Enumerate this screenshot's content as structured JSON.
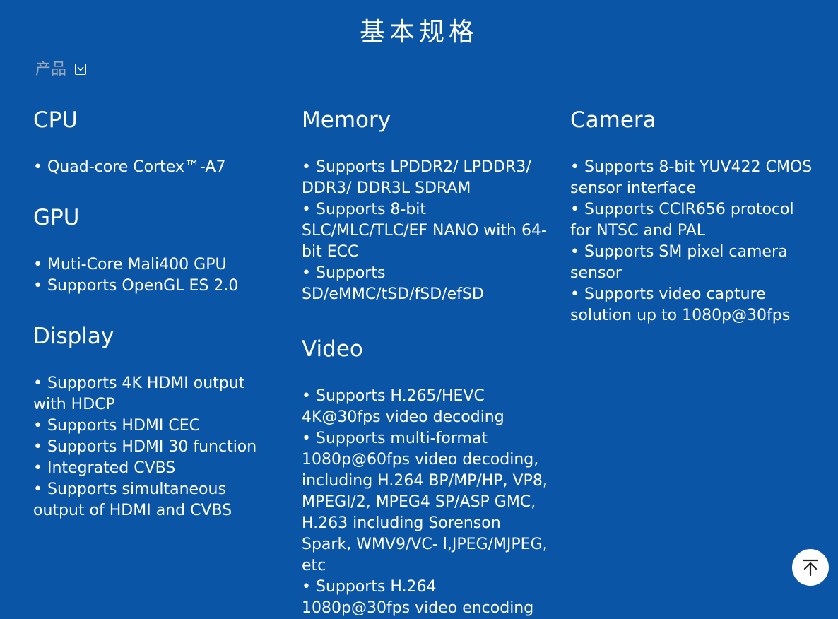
{
  "page_title": "基本规格",
  "filter": {
    "label": "产品",
    "icon": "chevron-down-icon"
  },
  "sections": {
    "cpu": {
      "title": "CPU",
      "items": [
        "Quad-core Cortex™-A7"
      ]
    },
    "gpu": {
      "title": "GPU",
      "items": [
        "Muti-Core Mali400 GPU",
        "Supports OpenGL ES 2.0"
      ]
    },
    "display": {
      "title": "Display",
      "items": [
        "Supports 4K HDMI output with HDCP",
        "Supports HDMI CEC",
        "Supports HDMI 30 function",
        "Integrated CVBS",
        "Supports simultaneous output of HDMI and CVBS"
      ]
    },
    "memory": {
      "title": "Memory",
      "items": [
        "Supports LPDDR2/ LPDDR3/ DDR3/ DDR3L SDRAM",
        "Supports 8-bit SLC/MLC/TLC/EF NANO with 64-bit ECC",
        "Supports SD/eMMC/tSD/fSD/efSD"
      ]
    },
    "video": {
      "title": "Video",
      "items": [
        "Supports H.265/HEVC 4K@30fps video decoding",
        "Supports multi-format 1080p@60fps video decoding, including H.264 BP/MP/HP, VP8, MPEGl/2, MPEG4 SP/ASP GMC, H.263 including Sorenson Spark, WMV9/VC- l,JPEG/MJPEG, etc",
        "Supports H.264 1080p@30fps video encoding"
      ]
    },
    "camera": {
      "title": "Camera",
      "items": [
        "Supports 8-bit YUV422 CMOS sensor interface",
        "Supports CCIR656 protocol for NTSC and PAL",
        "Supports SM pixel camera sensor",
        "Supports video capture solution up to 1080p@30fps"
      ]
    }
  },
  "back_to_top": {
    "icon": "arrow-up-to-top-icon"
  },
  "colors": {
    "background": "#0a55a6",
    "text": "#ffffff",
    "filter_label": "#9aa7b8"
  }
}
